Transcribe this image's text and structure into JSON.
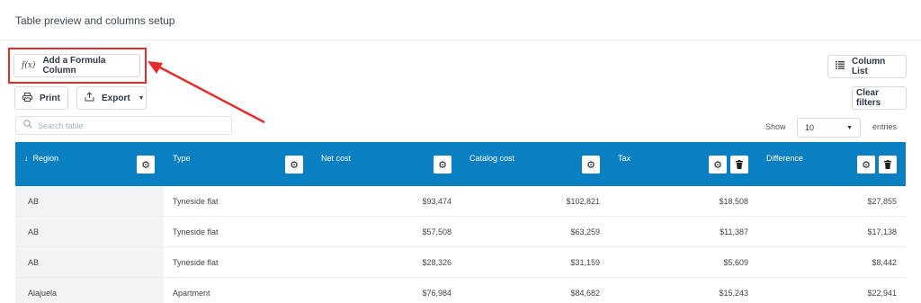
{
  "header": {
    "title": "Table preview and columns setup"
  },
  "toolbar": {
    "formula_label": "Add a Formula Column",
    "formula_icon": "f(x)",
    "column_list_label": "Column List",
    "print_label": "Print",
    "export_label": "Export",
    "clear_filters_label": "Clear filters"
  },
  "search": {
    "placeholder": "Search table"
  },
  "entries": {
    "show_label": "Show",
    "value": "10",
    "entries_label": "entries"
  },
  "columns": [
    "Region",
    "Type",
    "Net cost",
    "Catalog cost",
    "Tax",
    "Difference"
  ],
  "rows": [
    [
      "AB",
      "Tyneside flat",
      "$93,474",
      "$102,821",
      "$18,508",
      "$27,855"
    ],
    [
      "AB",
      "Tyneside flat",
      "$57,508",
      "$63,259",
      "$11,387",
      "$17,138"
    ],
    [
      "AB",
      "Tyneside flat",
      "$28,326",
      "$31,159",
      "$5,609",
      "$8,442"
    ],
    [
      "Alajuela",
      "Apartment",
      "$76,984",
      "$84,682",
      "$15,243",
      "$22,941"
    ]
  ],
  "colors": {
    "header_bg": "#0a7fc1",
    "annotation": "#e52b2b"
  }
}
